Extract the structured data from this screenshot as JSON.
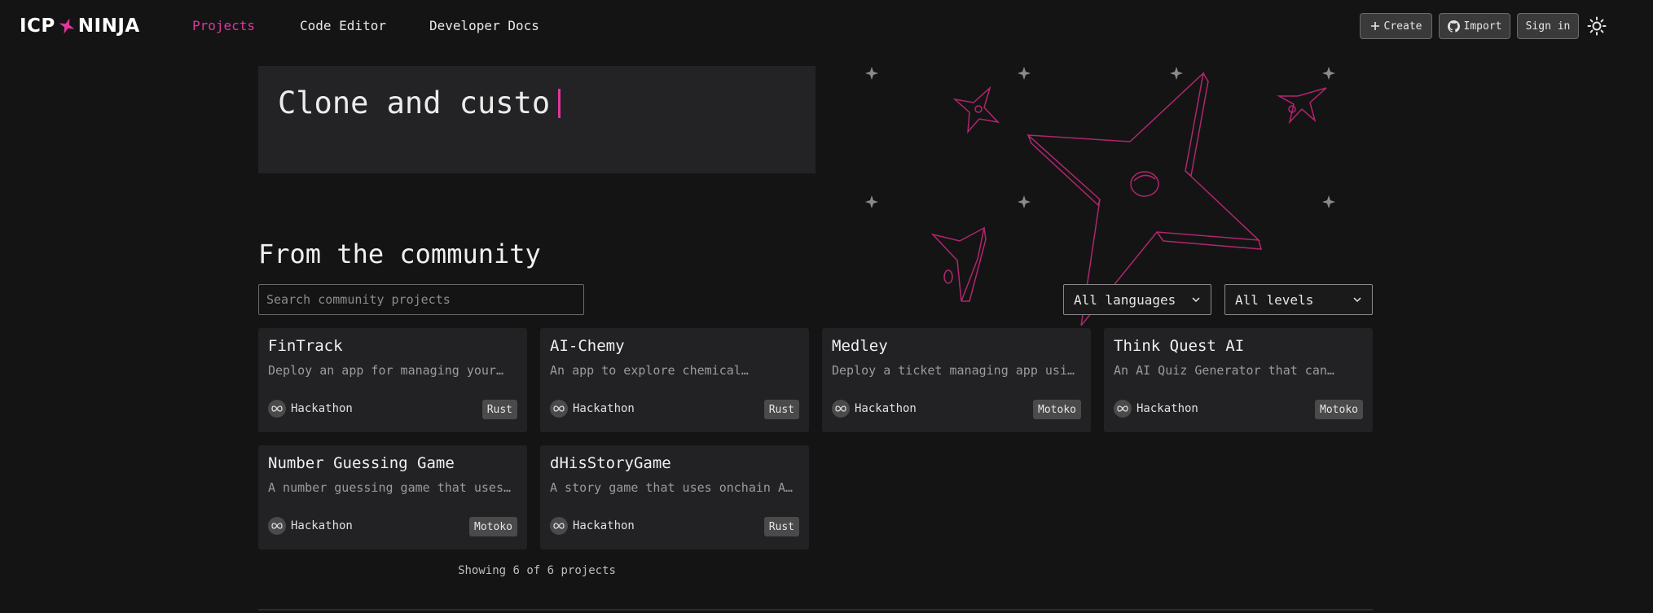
{
  "header": {
    "logo_left": "ICP",
    "logo_right": "NINJA",
    "nav": [
      {
        "label": "Projects",
        "active": true
      },
      {
        "label": "Code Editor",
        "active": false
      },
      {
        "label": "Developer Docs",
        "active": false
      }
    ],
    "buttons": {
      "create": "Create",
      "import": "Import",
      "signin": "Sign in"
    }
  },
  "hero": {
    "typed_text": "Clone and custo"
  },
  "community": {
    "title": "From the community",
    "search_placeholder": "Search community projects",
    "language_filter": "All languages",
    "level_filter": "All levels",
    "projects": [
      {
        "title": "FinTrack",
        "description": "Deploy an app for managing your…",
        "tag": "Hackathon",
        "language": "Rust"
      },
      {
        "title": "AI-Chemy",
        "description": "An app to explore chemical…",
        "tag": "Hackathon",
        "language": "Rust"
      },
      {
        "title": "Medley",
        "description": "Deploy a ticket managing app usin…",
        "tag": "Hackathon",
        "language": "Motoko"
      },
      {
        "title": "Think Quest AI",
        "description": "An AI Quiz Generator that can…",
        "tag": "Hackathon",
        "language": "Motoko"
      },
      {
        "title": "Number Guessing Game",
        "description": "A number guessing game that uses…",
        "tag": "Hackathon",
        "language": "Motoko"
      },
      {
        "title": "dHisStoryGame",
        "description": "A story game that uses onchain AI…",
        "tag": "Hackathon",
        "language": "Rust"
      }
    ],
    "showing": "Showing 6 of 6 projects"
  },
  "colors": {
    "accent": "#e0359e",
    "background": "#141414",
    "card": "#222124"
  },
  "icons": [
    "star-logo-icon",
    "plus-icon",
    "github-icon",
    "sun-icon",
    "chevron-down-icon",
    "infinity-icon"
  ]
}
